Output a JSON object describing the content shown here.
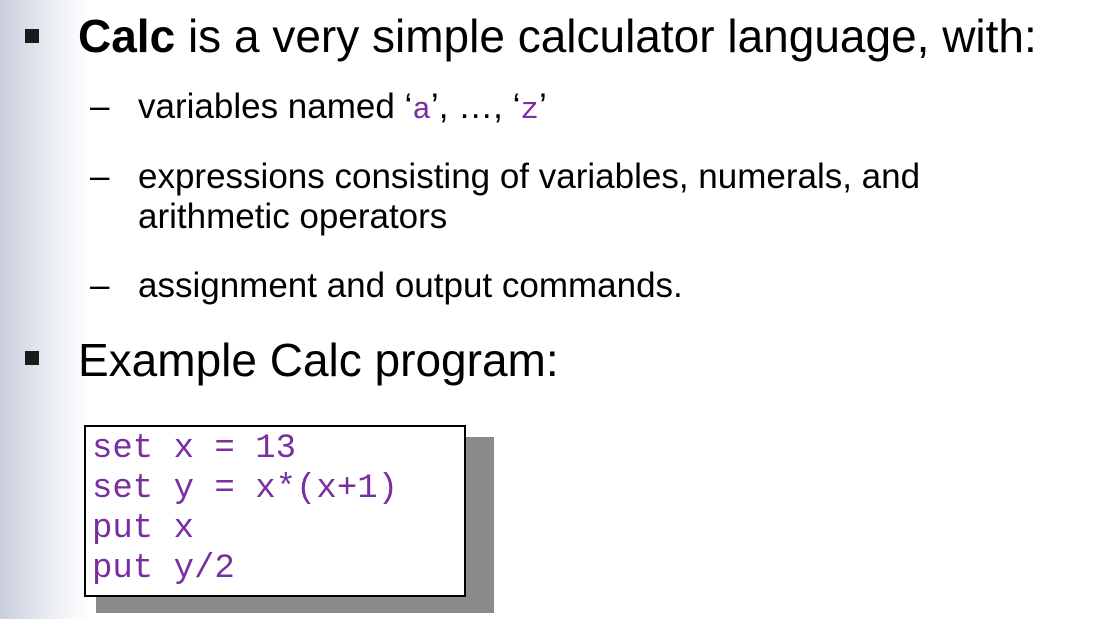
{
  "slide": {
    "bullet1": {
      "bold": "Calc",
      "rest": " is a very simple calculator language, with:"
    },
    "sub1": {
      "dash": "–",
      "prefix": "variables named ‘",
      "var_a": "a",
      "middle": "’, …, ‘",
      "var_z": "z",
      "suffix": "’"
    },
    "sub2": {
      "dash": "–",
      "line1": "expressions consisting of variables, numerals, and",
      "line2": "arithmetic operators"
    },
    "sub3": {
      "dash": "–",
      "text": "assignment and output commands."
    },
    "bullet2": {
      "text": "Example Calc program:"
    },
    "code": {
      "lines": [
        "set x = 13",
        "set y = x*(x+1)",
        "put x",
        "put y/2"
      ]
    }
  },
  "colors": {
    "code_text": "#7a2fa0",
    "bullet": "#1a1a1a",
    "left_band": "#c9cfdc"
  }
}
